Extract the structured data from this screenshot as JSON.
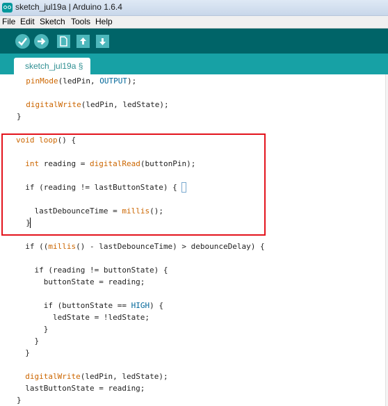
{
  "window": {
    "title": "sketch_jul19a | Arduino 1.6.4"
  },
  "menu": [
    "File",
    "Edit",
    "Sketch",
    "Tools",
    "Help"
  ],
  "toolbar": {
    "buttons": [
      "verify-icon",
      "upload-icon",
      "new-icon",
      "open-icon",
      "save-icon"
    ]
  },
  "tab": {
    "label": "sketch_jul19a §"
  },
  "colors": {
    "toolbar": "#006468",
    "tabbar": "#17a1a5",
    "keyword": "#cc6600",
    "constant": "#006699",
    "highlight": "#e3131c"
  },
  "code": [
    {
      "parts": [
        [
          "  ",
          ""
        ],
        [
          "pinMode",
          "kw"
        ],
        [
          "(ledPin, ",
          ""
        ],
        [
          "OUTPUT",
          "cst"
        ],
        [
          ");",
          ""
        ]
      ]
    },
    {
      "parts": [
        [
          "  ",
          ""
        ],
        [
          "digitalWrite",
          "kw"
        ],
        [
          "(ledPin, ledState);",
          ""
        ]
      ]
    },
    {
      "parts": [
        [
          "}",
          ""
        ]
      ]
    },
    {
      "parts": [
        [
          "void",
          "typ"
        ],
        [
          " ",
          ""
        ],
        [
          "loop",
          "kw"
        ],
        [
          "() {",
          ""
        ]
      ]
    },
    {
      "parts": [
        [
          "  ",
          ""
        ],
        [
          "int",
          "typ"
        ],
        [
          " reading = ",
          ""
        ],
        [
          "digitalRead",
          "kw"
        ],
        [
          "(buttonPin);",
          ""
        ]
      ]
    },
    {
      "parts": [
        [
          "  if (reading != lastButtonState) {",
          ""
        ]
      ]
    },
    {
      "parts": [
        [
          "    lastDebounceTime = ",
          ""
        ],
        [
          "millis",
          "kw"
        ],
        [
          "();",
          ""
        ]
      ]
    },
    {
      "parts": [
        [
          "  }",
          ""
        ]
      ]
    },
    {
      "parts": [
        [
          "  if ((",
          ""
        ],
        [
          "millis",
          "kw"
        ],
        [
          "() - lastDebounceTime) > debounceDelay) {",
          ""
        ]
      ]
    },
    {
      "parts": [
        [
          "    if (reading != buttonState) {",
          ""
        ]
      ]
    },
    {
      "parts": [
        [
          "      buttonState = reading;",
          ""
        ]
      ]
    },
    {
      "parts": [
        [
          "      if (buttonState == ",
          ""
        ],
        [
          "HIGH",
          "cst"
        ],
        [
          ") {",
          ""
        ]
      ]
    },
    {
      "parts": [
        [
          "        ledState = !ledState;",
          ""
        ]
      ]
    },
    {
      "parts": [
        [
          "      }",
          ""
        ]
      ]
    },
    {
      "parts": [
        [
          "    }",
          ""
        ]
      ]
    },
    {
      "parts": [
        [
          "  }",
          ""
        ]
      ]
    },
    {
      "parts": [
        [
          "  ",
          ""
        ],
        [
          "digitalWrite",
          "kw"
        ],
        [
          "(ledPin, ledState);",
          ""
        ]
      ]
    },
    {
      "parts": [
        [
          "  lastButtonState = reading;",
          ""
        ]
      ]
    },
    {
      "parts": [
        [
          "}",
          ""
        ]
      ]
    }
  ]
}
